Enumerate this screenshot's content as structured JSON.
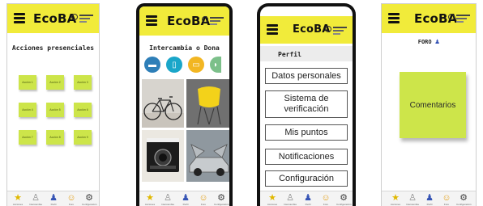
{
  "brand": "EcoBA",
  "screens": [
    {
      "heading": "Acciones presenciales",
      "notes": [
        "Acción 1",
        "Acción 2",
        "Acción 3",
        "Acción 4",
        "Acción 5",
        "Acción 6",
        "Acción 7",
        "Acción 8",
        "Acción 9"
      ]
    },
    {
      "heading": "Intercambia o Dona",
      "categories": [
        "car-icon",
        "phone-icon",
        "sofa-icon",
        "clothing-icon"
      ],
      "photos": [
        "bicycle-photo",
        "yellow-chair-photo",
        "polaroid-camera-photo",
        "delorean-car-photo"
      ]
    },
    {
      "heading": "Perfil",
      "menu": [
        "Datos personales",
        "Sistema de verificación",
        "Mis puntos",
        "Notificaciones",
        "Configuración"
      ]
    },
    {
      "heading": "FORO",
      "note": "Comentarios"
    }
  ],
  "nav": [
    {
      "icon": "star-icon",
      "label": "Acciones"
    },
    {
      "icon": "person-outline-icon",
      "label": "Intercambia"
    },
    {
      "icon": "user-icon",
      "label": "Perfil"
    },
    {
      "icon": "smile-icon",
      "label": "Foro"
    },
    {
      "icon": "gear-icon",
      "label": "Configuración"
    }
  ],
  "colors": {
    "appbar": "#f1eb3a",
    "note": "#cde54a",
    "category": [
      "#2e7fb8",
      "#1aa6c9",
      "#f2b622",
      "#7cc08a"
    ]
  }
}
